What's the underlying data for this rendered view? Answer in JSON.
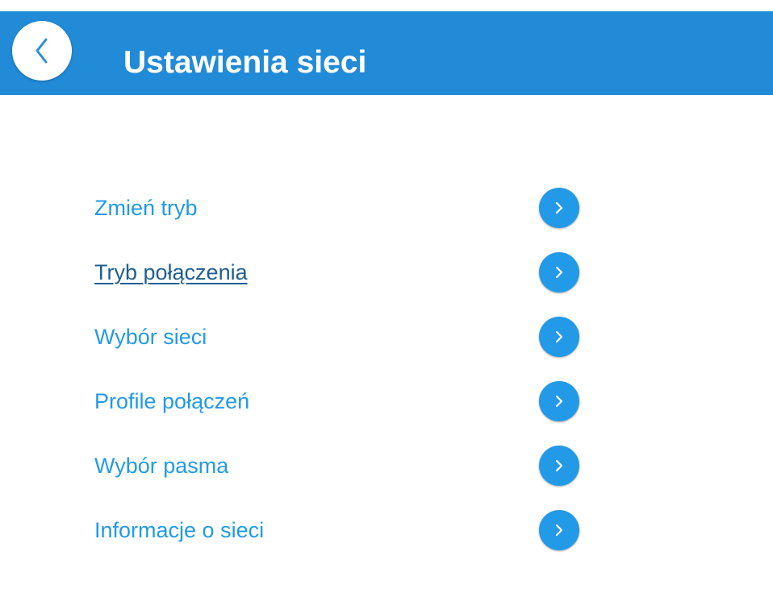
{
  "header": {
    "title": "Ustawienia sieci",
    "back_icon": "chevron-left-icon"
  },
  "menu": {
    "items": [
      {
        "label": "Zmień tryb",
        "icon": "chevron-right-icon"
      },
      {
        "label": "Tryb połączenia",
        "icon": "chevron-right-icon",
        "active": true
      },
      {
        "label": "Wybór sieci",
        "icon": "chevron-right-icon"
      },
      {
        "label": "Profile połączeń",
        "icon": "chevron-right-icon"
      },
      {
        "label": "Wybór pasma",
        "icon": "chevron-right-icon"
      },
      {
        "label": "Informacje o sieci",
        "icon": "chevron-right-icon"
      }
    ]
  },
  "colors": {
    "header_background": "#228bd8",
    "link": "#229ae8",
    "link_active": "#1f5f93",
    "chevron_background": "#229ae8"
  }
}
